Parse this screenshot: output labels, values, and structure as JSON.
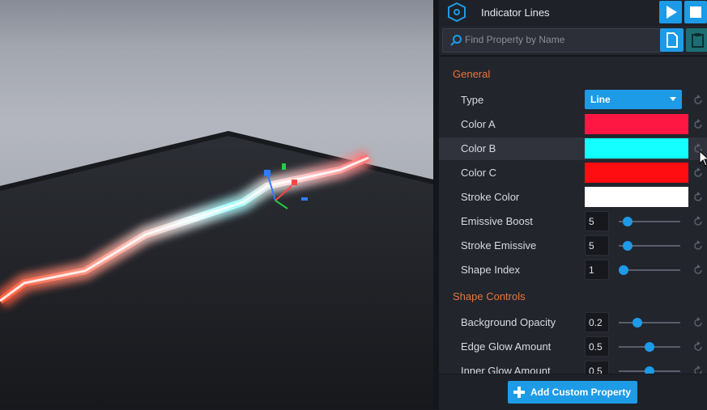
{
  "header": {
    "title": "Indicator Lines",
    "play_icon": "play-icon",
    "stop_icon": "stop-icon"
  },
  "search": {
    "placeholder": "Find Property by Name"
  },
  "sections": {
    "general": "General",
    "shape_controls": "Shape Controls"
  },
  "properties": {
    "type": {
      "label": "Type",
      "value": "Line"
    },
    "color_a": {
      "label": "Color A",
      "color": "#ff1744"
    },
    "color_b": {
      "label": "Color B",
      "color": "#14ffff"
    },
    "color_c": {
      "label": "Color C",
      "color": "#ff0d10"
    },
    "stroke_color": {
      "label": "Stroke Color",
      "color": "#ffffff"
    },
    "emissive_boost": {
      "label": "Emissive Boost",
      "value": "5"
    },
    "stroke_emissive": {
      "label": "Stroke Emissive",
      "value": "5"
    },
    "shape_index": {
      "label": "Shape Index",
      "value": "1"
    },
    "background_opacity": {
      "label": "Background Opacity",
      "value": "0.2"
    },
    "edge_glow_amount": {
      "label": "Edge Glow Amount",
      "value": "0.5"
    },
    "inner_glow_amount": {
      "label": "Inner Glow Amount",
      "value": "0.5"
    }
  },
  "footer": {
    "add_label": "Add Custom Property"
  },
  "colors": {
    "accent": "#1d9be6",
    "section": "#e8753a",
    "panel": "#23252d"
  }
}
